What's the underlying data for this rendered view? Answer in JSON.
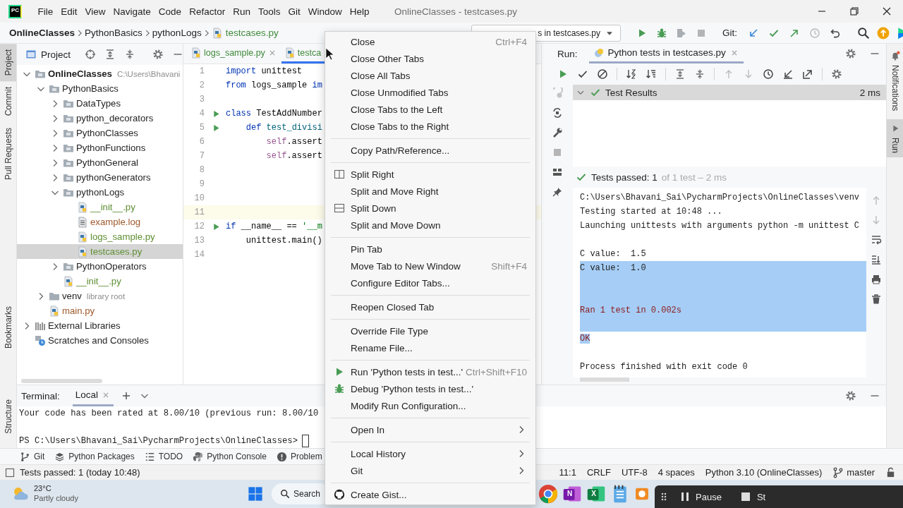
{
  "app": {
    "logo": "PC"
  },
  "menu_bar": [
    "File",
    "Edit",
    "View",
    "Navigate",
    "Code",
    "Refactor",
    "Run",
    "Tools",
    "Git",
    "Window",
    "Help"
  ],
  "window": {
    "title": "OnlineClasses - testcases.py"
  },
  "breadcrumbs": [
    {
      "label": "OnlineClasses",
      "kind": "project",
      "color": "#1f1f1f"
    },
    {
      "label": "PythonBasics",
      "kind": "folder",
      "color": "#1f1f1f"
    },
    {
      "label": "pythonLogs",
      "kind": "folder",
      "color": "#1f1f1f"
    },
    {
      "label": "testcases.py",
      "kind": "file",
      "color": "#3f8a3a"
    }
  ],
  "run_config": {
    "label": "s in testcases.py"
  },
  "vcs": {
    "label": "Git:"
  },
  "left_stripe": {
    "top": [
      {
        "label": "Project",
        "selected": true
      },
      {
        "label": "Commit",
        "selected": false
      },
      {
        "label": "Pull Requests",
        "selected": false
      }
    ],
    "bottom": [
      {
        "label": "Bookmarks",
        "selected": false
      },
      {
        "label": "Structure",
        "selected": false
      }
    ]
  },
  "right_stripe": [
    {
      "label": "Notifications",
      "selected": false
    },
    {
      "label": "Run",
      "selected": true
    }
  ],
  "project_panel": {
    "title": "Project",
    "tree": [
      {
        "label": "OnlineClasses",
        "kind": "module",
        "hint": "C:\\Users\\Bhavani",
        "expanded": true,
        "selected": false,
        "color": "#1f1f1f",
        "children": [
          {
            "label": "PythonBasics",
            "kind": "module",
            "expanded": true,
            "selected": false,
            "color": "#1f1f1f",
            "children": [
              {
                "label": "DataTypes",
                "kind": "module",
                "expanded": false,
                "selected": false,
                "color": "#1f1f1f"
              },
              {
                "label": "python_decorators",
                "kind": "module",
                "expanded": false,
                "selected": false,
                "color": "#1f1f1f"
              },
              {
                "label": "PythonClasses",
                "kind": "module",
                "expanded": false,
                "selected": false,
                "color": "#1f1f1f"
              },
              {
                "label": "PythonFunctions",
                "kind": "module",
                "expanded": false,
                "selected": false,
                "color": "#1f1f1f"
              },
              {
                "label": "PythonGeneral",
                "kind": "module",
                "expanded": false,
                "selected": false,
                "color": "#1f1f1f"
              },
              {
                "label": "pythonGenerators",
                "kind": "module",
                "expanded": false,
                "selected": false,
                "color": "#1f1f1f"
              },
              {
                "label": "pythonLogs",
                "kind": "module",
                "expanded": true,
                "selected": false,
                "color": "#1f1f1f",
                "children": [
                  {
                    "label": "__init__.py",
                    "kind": "python",
                    "selected": false,
                    "color": "#5e8f32"
                  },
                  {
                    "label": "example.log",
                    "kind": "log",
                    "selected": false,
                    "color": "#a0592c"
                  },
                  {
                    "label": "logs_sample.py",
                    "kind": "python",
                    "selected": false,
                    "color": "#5e8f32"
                  },
                  {
                    "label": "testcases.py",
                    "kind": "python",
                    "selected": true,
                    "color": "#5e8f32"
                  }
                ]
              },
              {
                "label": "PythonOperators",
                "kind": "module",
                "expanded": false,
                "selected": false,
                "color": "#1f1f1f"
              },
              {
                "label": "__init__.py",
                "kind": "python",
                "selected": false,
                "color": "#5e8f32"
              }
            ]
          },
          {
            "label": "venv",
            "kind": "folder",
            "hint": "library root",
            "expanded": false,
            "selected": false,
            "color": "#1f1f1f"
          },
          {
            "label": "main.py",
            "kind": "python",
            "selected": false,
            "color": "#a0592c"
          }
        ]
      },
      {
        "label": "External Libraries",
        "kind": "library",
        "expanded": false,
        "selected": false,
        "color": "#1f1f1f"
      },
      {
        "label": "Scratches and Consoles",
        "kind": "scratches",
        "selected": false,
        "color": "#1f1f1f"
      }
    ]
  },
  "editor": {
    "tabs": [
      {
        "label": "logs_sample.py",
        "selected": false,
        "closable": true
      },
      {
        "label": "testca",
        "selected": true,
        "closable": false
      }
    ],
    "lines": [
      {
        "number": "1",
        "current": false,
        "runnable": false,
        "tokens": [
          {
            "text": "import",
            "kind": "keyword"
          },
          {
            "text": " unittest",
            "kind": "plain"
          }
        ]
      },
      {
        "number": "2",
        "current": false,
        "runnable": false,
        "tokens": [
          {
            "text": "from",
            "kind": "keyword"
          },
          {
            "text": " logs_sample ",
            "kind": "plain"
          },
          {
            "text": "im",
            "kind": "keyword"
          }
        ]
      },
      {
        "number": "3",
        "current": false,
        "runnable": false
      },
      {
        "number": "4",
        "current": false,
        "runnable": true,
        "tokens": [
          {
            "text": "class",
            "kind": "keyword"
          },
          {
            "text": " TestAddNumber",
            "kind": "plain"
          }
        ]
      },
      {
        "number": "5",
        "current": false,
        "runnable": true,
        "tokens": [
          {
            "text": "    def",
            "kind": "keyword"
          },
          {
            "text": " test_divisi",
            "kind": "function"
          }
        ]
      },
      {
        "number": "6",
        "current": false,
        "runnable": false,
        "tokens": [
          {
            "text": "        self",
            "kind": "self"
          },
          {
            "text": ".assert",
            "kind": "plain"
          }
        ]
      },
      {
        "number": "7",
        "current": false,
        "runnable": false,
        "tokens": [
          {
            "text": "        self",
            "kind": "self"
          },
          {
            "text": ".assert",
            "kind": "plain"
          }
        ]
      },
      {
        "number": "8",
        "current": false,
        "runnable": false
      },
      {
        "number": "9",
        "current": false,
        "runnable": false
      },
      {
        "number": "10",
        "current": false,
        "runnable": false
      },
      {
        "number": "11",
        "current": true,
        "runnable": false
      },
      {
        "number": "12",
        "current": false,
        "runnable": true,
        "tokens": [
          {
            "text": "if",
            "kind": "keyword"
          },
          {
            "text": " __name__ == ",
            "kind": "plain"
          },
          {
            "text": "'__m",
            "kind": "string"
          }
        ]
      },
      {
        "number": "13",
        "current": false,
        "runnable": false,
        "tokens": [
          {
            "text": "    unittest.main()",
            "kind": "plain"
          }
        ]
      },
      {
        "number": "14",
        "current": false,
        "runnable": false
      }
    ]
  },
  "run_panel": {
    "title": "Run:",
    "tab": {
      "label": "Python tests in testcases.py"
    },
    "results": {
      "label": "Test Results",
      "time": "2 ms"
    },
    "summary": {
      "status": "Tests passed: 1",
      "detail": "of 1 test – 2 ms"
    },
    "console": [
      {
        "kind": "out",
        "selected": false,
        "text": "C:\\Users\\Bhavani_Sai\\PycharmProjects\\OnlineClasses\\venv"
      },
      {
        "kind": "out",
        "selected": false,
        "text": "Testing started at 10:48 ..."
      },
      {
        "kind": "out",
        "selected": false,
        "text": "Launching unittests with arguments python -m unittest C"
      },
      {
        "kind": "out",
        "selected": false
      },
      {
        "kind": "out",
        "selected": false,
        "text": "C value:  1.5"
      },
      {
        "kind": "out",
        "selected": true,
        "text": "C value:  1.0"
      },
      {
        "kind": "out",
        "selected": true
      },
      {
        "kind": "out",
        "selected": true
      },
      {
        "kind": "err",
        "selected": true,
        "text": "Ran 1 test in 0.002s"
      },
      {
        "kind": "err",
        "selected": true
      },
      {
        "kind": "err",
        "selected": true,
        "text": "OK"
      },
      {
        "kind": "out",
        "selected": false
      },
      {
        "kind": "out",
        "selected": false,
        "text": "Process finished with exit code 0"
      }
    ]
  },
  "terminal": {
    "title": "Terminal:",
    "tabs": [
      {
        "label": "Local",
        "selected": true
      }
    ],
    "lines": [
      {
        "kind": "output",
        "text": "Your code has been rated at 8.00/10 (previous run: 8.00/10"
      },
      {
        "kind": "blank"
      },
      {
        "kind": "prompt",
        "text": "PS C:\\Users\\Bhavani_Sai\\PycharmProjects\\OnlineClasses>"
      }
    ]
  },
  "tool_windows": [
    {
      "label": "Git",
      "kind": "git"
    },
    {
      "label": "Python Packages",
      "kind": "packages"
    },
    {
      "label": "TODO",
      "kind": "todo"
    },
    {
      "label": "Python Console",
      "kind": "console"
    },
    {
      "label": "Problem",
      "kind": "problems"
    }
  ],
  "status_bar": {
    "message": "Tests passed: 1 (today 10:48)",
    "items": [
      "11:1",
      "CRLF",
      "UTF-8",
      "4 spaces",
      "Python 3.10 (OnlineClasses)"
    ],
    "branch": "master"
  },
  "context_menu": [
    {
      "kind": "item",
      "label": "Close",
      "shortcut": "Ctrl+F4"
    },
    {
      "kind": "item",
      "label": "Close Other Tabs"
    },
    {
      "kind": "item",
      "label": "Close All Tabs"
    },
    {
      "kind": "item",
      "label": "Close Unmodified Tabs"
    },
    {
      "kind": "item",
      "label": "Close Tabs to the Left"
    },
    {
      "kind": "item",
      "label": "Close Tabs to the Right"
    },
    {
      "kind": "separator"
    },
    {
      "kind": "item",
      "label": "Copy Path/Reference..."
    },
    {
      "kind": "separator"
    },
    {
      "kind": "split-right",
      "label": "Split Right"
    },
    {
      "kind": "item",
      "label": "Split and Move Right"
    },
    {
      "kind": "split-down",
      "label": "Split Down"
    },
    {
      "kind": "item",
      "label": "Split and Move Down"
    },
    {
      "kind": "separator"
    },
    {
      "kind": "item",
      "label": "Pin Tab"
    },
    {
      "kind": "item",
      "label": "Move Tab to New Window",
      "shortcut": "Shift+F4"
    },
    {
      "kind": "item",
      "label": "Configure Editor Tabs..."
    },
    {
      "kind": "separator"
    },
    {
      "kind": "item",
      "label": "Reopen Closed Tab"
    },
    {
      "kind": "separator"
    },
    {
      "kind": "item",
      "label": "Override File Type"
    },
    {
      "kind": "item",
      "label": "Rename File..."
    },
    {
      "kind": "separator"
    },
    {
      "kind": "run",
      "label": "Run 'Python tests in test...'",
      "shortcut": "Ctrl+Shift+F10"
    },
    {
      "kind": "debug",
      "label": "Debug 'Python tests in test...'"
    },
    {
      "kind": "item",
      "label": "Modify Run Configuration..."
    },
    {
      "kind": "separator"
    },
    {
      "kind": "item",
      "label": "Open In",
      "submenu": true
    },
    {
      "kind": "separator"
    },
    {
      "kind": "item",
      "label": "Local History",
      "submenu": true
    },
    {
      "kind": "item",
      "label": "Git",
      "submenu": true
    },
    {
      "kind": "separator"
    },
    {
      "kind": "gist",
      "label": "Create Gist..."
    }
  ],
  "taskbar": {
    "weather": {
      "temp": "23°C",
      "condition": "Partly cloudy"
    },
    "search": "Search",
    "apps": [
      {
        "kind": "chrome"
      },
      {
        "kind": "onenote",
        "letter": "N"
      },
      {
        "kind": "excel",
        "letter": "X"
      },
      {
        "kind": "notepad"
      },
      {
        "kind": "orange"
      }
    ]
  },
  "recorder": {
    "pause": "Pause",
    "stop": "St"
  }
}
